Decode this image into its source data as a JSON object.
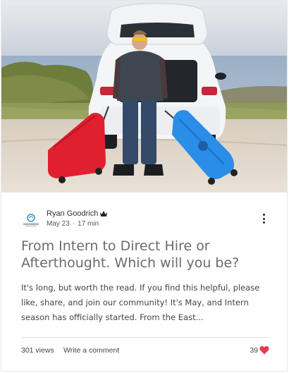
{
  "post": {
    "author": {
      "name": "Ryan Goodrich",
      "role_icon": "crown-icon",
      "date": "May 23",
      "separator": "·",
      "read_time": "17 min"
    },
    "title": "From Intern to Direct Hire or Afterthought. Which will you be?",
    "excerpt": "It's long, but worth the read. If you find this helpful, please like, share, and join our community! It's May, and Intern season has officially started. From the East...",
    "stats": {
      "views": "301 views",
      "comment_label": "Write a comment",
      "likes": "39"
    }
  },
  "colors": {
    "heart": "#e8394b",
    "title": "#6b6b6b",
    "suitcase_red": "#e0202f",
    "suitcase_blue": "#2a8ee8"
  },
  "icons": [
    "crown-icon",
    "more-options-icon",
    "heart-icon",
    "blog-logo-icon"
  ]
}
